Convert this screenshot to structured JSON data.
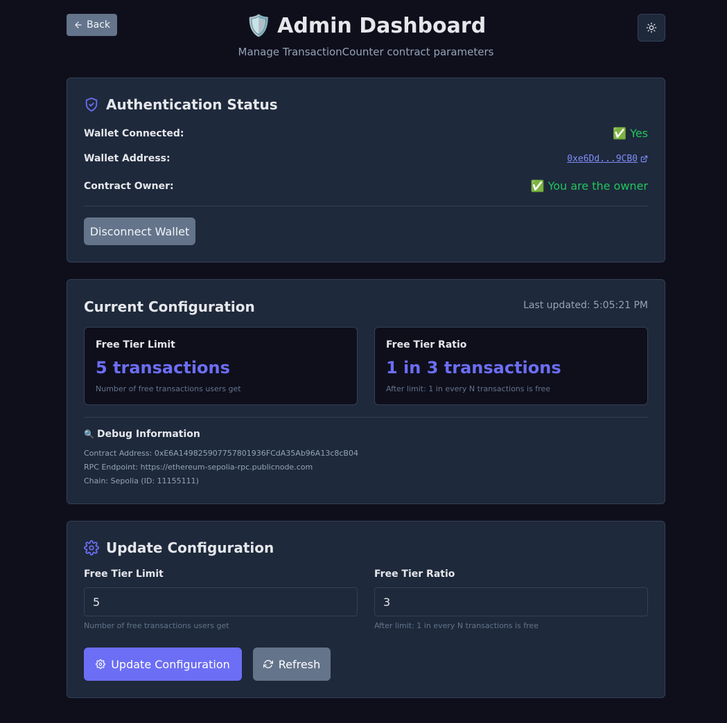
{
  "header": {
    "back_label": "Back",
    "title_emoji": "🛡️",
    "title": "Admin Dashboard",
    "subtitle": "Manage TransactionCounter contract parameters"
  },
  "auth": {
    "title": "Authentication Status",
    "wallet_connected_label": "Wallet Connected:",
    "wallet_connected_value": "✅ Yes",
    "wallet_address_label": "Wallet Address:",
    "wallet_address_value": "0xe6Dd...9CB0",
    "contract_owner_label": "Contract Owner:",
    "contract_owner_value": "✅ You are the owner",
    "disconnect_label": "Disconnect Wallet"
  },
  "config": {
    "title": "Current Configuration",
    "last_updated": "Last updated: 5:05:21 PM",
    "free_tier_limit": {
      "label": "Free Tier Limit",
      "value": "5 transactions",
      "hint": "Number of free transactions users get"
    },
    "free_tier_ratio": {
      "label": "Free Tier Ratio",
      "value": "1 in 3 transactions",
      "hint": "After limit: 1 in every N transactions is free"
    },
    "debug": {
      "emoji": "🔍",
      "title": "Debug Information",
      "contract_address": "Contract Address: 0xE6A149825907757801936FCdA35Ab96A13c8cB04",
      "rpc_endpoint": "RPC Endpoint: https://ethereum-sepolia-rpc.publicnode.com",
      "chain": "Chain: Sepolia (ID: 11155111)"
    }
  },
  "update": {
    "title": "Update Configuration",
    "limit_label": "Free Tier Limit",
    "limit_value": "5",
    "limit_hint": "Number of free transactions users get",
    "ratio_label": "Free Tier Ratio",
    "ratio_value": "3",
    "ratio_hint": "After limit: 1 in every N transactions is free",
    "update_button": "Update Configuration",
    "refresh_button": "Refresh"
  },
  "colors": {
    "accent": "#6c6ef5",
    "success": "#22c55e",
    "background": "#0f0f1c",
    "card": "#1e293b"
  }
}
